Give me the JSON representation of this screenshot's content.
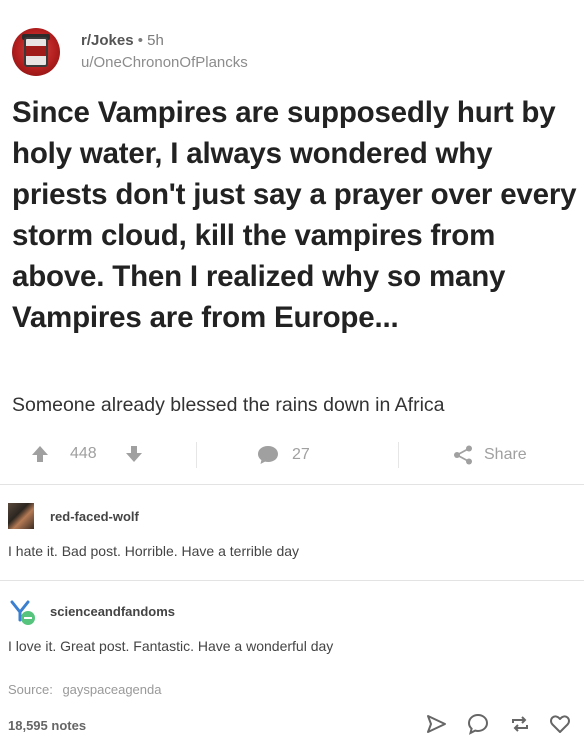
{
  "post": {
    "subreddit": "r/Jokes",
    "separator": "•",
    "time": "5h",
    "user": "u/OneChrononOfPlancks",
    "title": "Since Vampires are supposedly hurt by holy water, I always wondered why priests don't just say a prayer over every storm cloud, kill the vampires from above. Then I realized why so many Vampires are from Europe...",
    "body": "Someone already blessed the rains down in Africa",
    "votes": "448",
    "comments": "27",
    "share_label": "Share"
  },
  "reblogs": [
    {
      "username": "red-faced-wolf",
      "text": "I hate it. Bad post. Horrible. Have a terrible day"
    },
    {
      "username": "scienceandfandoms",
      "text": "I love it. Great post. Fantastic. Have a wonderful day"
    }
  ],
  "footer": {
    "source_label": "Source:",
    "source_value": "gayspaceagenda",
    "notes": "18,595 notes"
  },
  "colors": {
    "text": "#222222",
    "muted": "#a0a0a0",
    "divider": "#e3e3e3",
    "avatar_red": "#b31e1e",
    "sci_green": "#56c47c",
    "sci_blue": "#3a7fd0"
  },
  "icons": [
    "upvote-icon",
    "downvote-icon",
    "comment-icon",
    "share-icon",
    "send-icon",
    "reply-icon",
    "reblog-icon",
    "like-icon"
  ]
}
